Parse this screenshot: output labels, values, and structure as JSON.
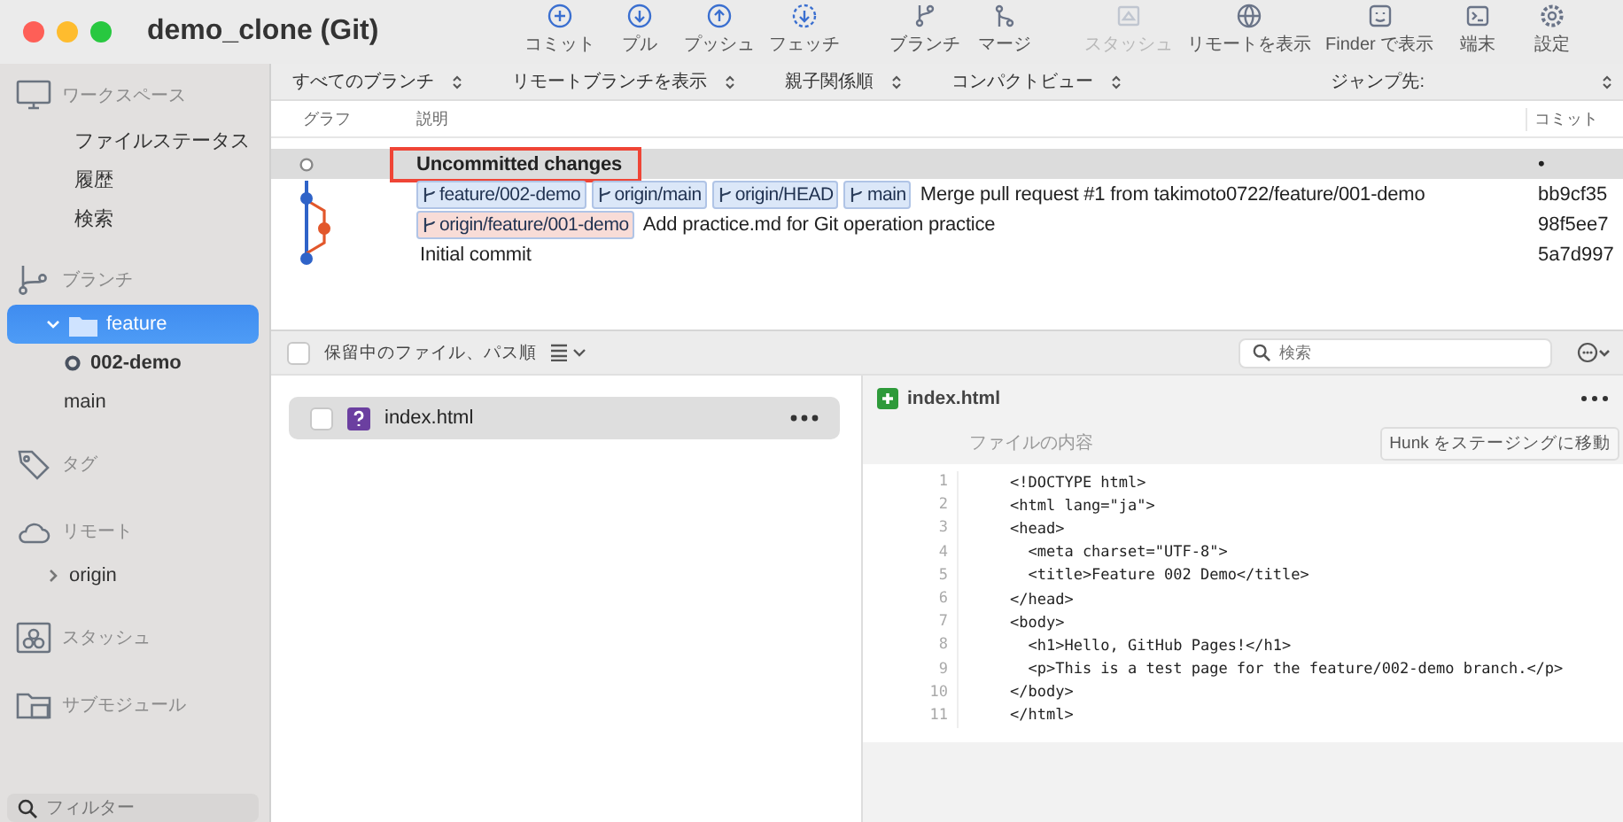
{
  "window": {
    "title": "demo_clone (Git)"
  },
  "toolbar": {
    "buttons": [
      {
        "label": "コミット",
        "disabled": false
      },
      {
        "label": "プル",
        "disabled": false
      },
      {
        "label": "プッシュ",
        "disabled": false
      },
      {
        "label": "フェッチ",
        "disabled": false
      },
      {
        "label": "ブランチ",
        "disabled": false
      },
      {
        "label": "マージ",
        "disabled": false
      },
      {
        "label": "スタッシュ",
        "disabled": true
      },
      {
        "label": "リモートを表示",
        "disabled": false
      },
      {
        "label": "Finder で表示",
        "disabled": false
      },
      {
        "label": "端末",
        "disabled": false
      },
      {
        "label": "設定",
        "disabled": false
      }
    ]
  },
  "sidebar": {
    "sections": [
      {
        "kind": "workspace",
        "label": "ワークスペース",
        "items": [
          {
            "label": "ファイルステータス",
            "selected": false
          },
          {
            "label": "履歴",
            "selected": false
          },
          {
            "label": "検索",
            "selected": false
          }
        ]
      },
      {
        "kind": "branches",
        "label": "ブランチ",
        "items": [
          {
            "label": "feature",
            "selected": true,
            "expanded": true,
            "children": [
              {
                "label": "002-demo",
                "current": true,
                "selected": false
              },
              {
                "label": "main",
                "current": false,
                "selected": false
              }
            ]
          }
        ]
      },
      {
        "kind": "tags",
        "label": "タグ"
      },
      {
        "kind": "remotes",
        "label": "リモート",
        "items": [
          {
            "label": "origin",
            "selected": false,
            "expanded": false
          }
        ]
      },
      {
        "kind": "stashes",
        "label": "スタッシュ"
      },
      {
        "kind": "submodules",
        "label": "サブモジュール"
      }
    ],
    "filter": {
      "placeholder": "フィルター"
    }
  },
  "filter_bar": {
    "options": [
      "すべてのブランチ",
      "リモートブランチを表示",
      "親子関係順",
      "コンパクトビュー"
    ],
    "jump_label": "ジャンプ先:"
  },
  "commits": {
    "columns": [
      "グラフ",
      "説明",
      "コミット"
    ],
    "rows": [
      {
        "description": "Uncommitted changes",
        "hash": "•",
        "selected": true,
        "outlined": true,
        "bold": true
      },
      {
        "refs": [
          {
            "label": "feature/002-demo",
            "color": "#dbe7f8"
          },
          {
            "label": "origin/main",
            "color": "#dbe7f8"
          },
          {
            "label": "origin/HEAD",
            "color": "#dbe7f8"
          },
          {
            "label": "main",
            "color": "#dbe7f8"
          }
        ],
        "description": "Merge pull request #1 from takimoto0722/feature/001-demo",
        "hash": "bb9cf35",
        "selected": false,
        "outlined": false,
        "bold": false
      },
      {
        "refs": [
          {
            "label": "origin/feature/001-demo",
            "color": "#f8dcd7"
          }
        ],
        "description": "Add practice.md for Git operation practice",
        "hash": "98f5ee7",
        "selected": false,
        "outlined": false,
        "bold": false
      },
      {
        "description": "Initial commit",
        "hash": "5a7d997",
        "selected": false,
        "outlined": false,
        "bold": false
      }
    ]
  },
  "staging": {
    "all_checked": false,
    "sort_label": "保留中のファイル、パス順",
    "search": {
      "placeholder": "検索"
    },
    "files": [
      {
        "name": "index.html",
        "checked": false,
        "selected": true
      }
    ]
  },
  "diff": {
    "file": "index.html",
    "header": "ファイルの内容",
    "stage_button": "Hunk をステージングに移動",
    "lines": [
      {
        "number": "1",
        "text": "<!DOCTYPE html>"
      },
      {
        "number": "2",
        "text": "<html lang=\"ja\">"
      },
      {
        "number": "3",
        "text": "<head>"
      },
      {
        "number": "4",
        "text": "  <meta charset=\"UTF-8\">"
      },
      {
        "number": "5",
        "text": "  <title>Feature 002 Demo</title>"
      },
      {
        "number": "6",
        "text": "</head>"
      },
      {
        "number": "7",
        "text": "<body>"
      },
      {
        "number": "8",
        "text": "  <h1>Hello, GitHub Pages!</h1>"
      },
      {
        "number": "9",
        "text": "  <p>This is a test page for the feature/002-demo branch.</p>"
      },
      {
        "number": "10",
        "text": "</body>"
      },
      {
        "number": "11",
        "text": "</html>"
      }
    ]
  }
}
